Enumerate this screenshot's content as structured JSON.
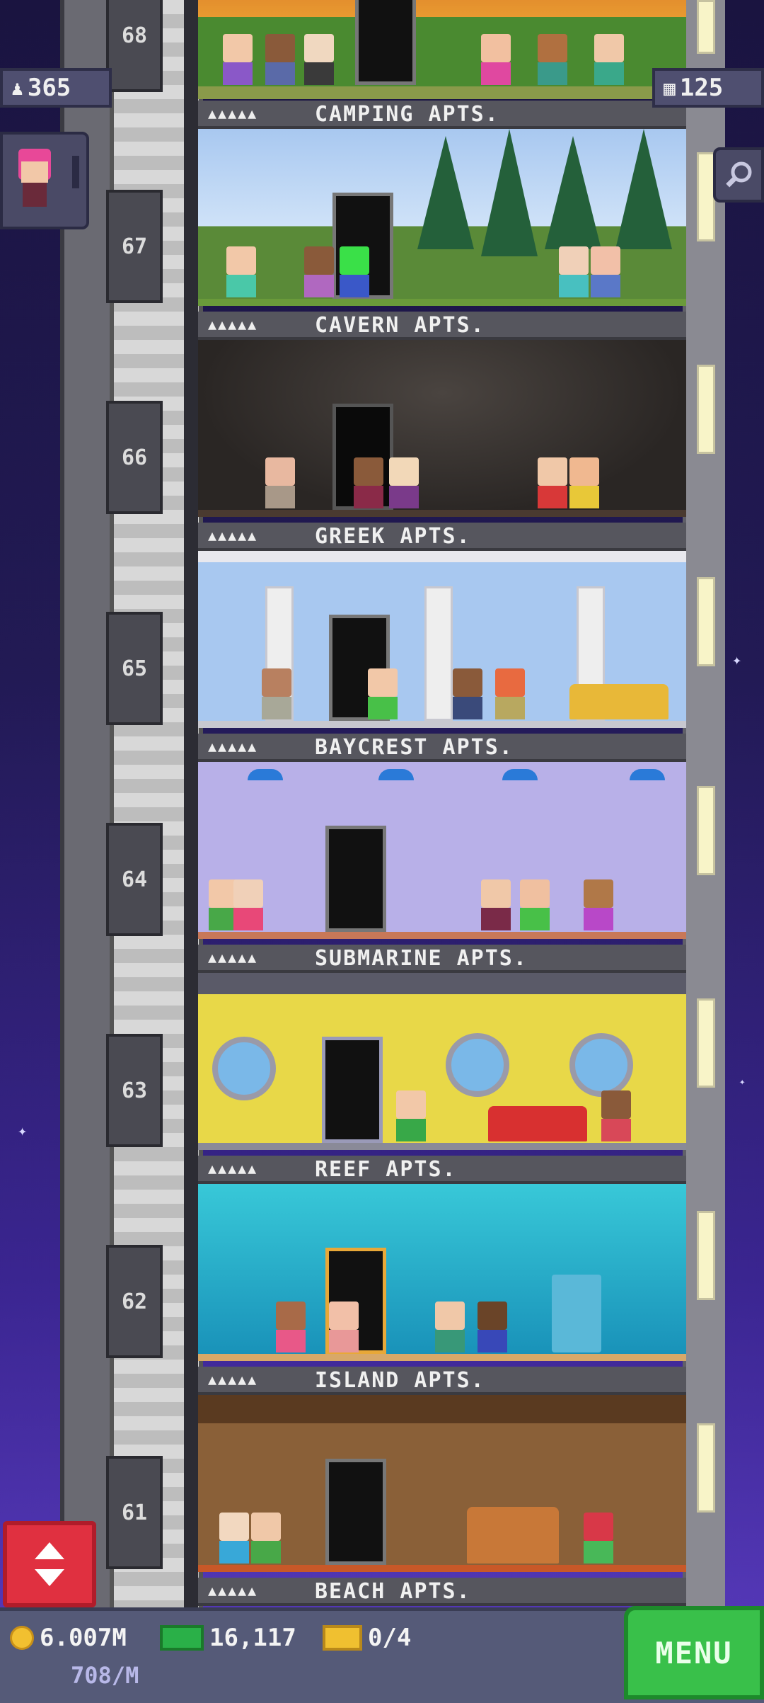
{
  "hud": {
    "population": "365",
    "floors_count": "125",
    "icons": {
      "population": "person-icon",
      "floors": "building-icon",
      "search": "search-icon",
      "elevator": "elevator-arrows-icon"
    }
  },
  "floors": [
    {
      "number": "68",
      "name": "CAMPING APTS.",
      "stars": "▲▲▲▲▲"
    },
    {
      "number": "67",
      "name": "CAVERN APTS.",
      "stars": "▲▲▲▲▲"
    },
    {
      "number": "66",
      "name": "GREEK APTS.",
      "stars": "▲▲▲▲▲"
    },
    {
      "number": "65",
      "name": "BAYCREST APTS.",
      "stars": "▲▲▲▲▲"
    },
    {
      "number": "64",
      "name": "SUBMARINE APTS.",
      "stars": "▲▲▲▲▲"
    },
    {
      "number": "63",
      "name": "REEF APTS.",
      "stars": "▲▲▲▲▲"
    },
    {
      "number": "62",
      "name": "ISLAND APTS.",
      "stars": "▲▲▲▲▲"
    },
    {
      "number": "61",
      "name": "BEACH APTS.",
      "stars": "▲▲▲▲▲"
    }
  ],
  "bottom_bar": {
    "coins": "6.007M",
    "coin_rate": "708/M",
    "bux": "16,117",
    "tickets": "0/4",
    "menu_label": "MENU"
  },
  "colors": {
    "accent_menu": "#39c04a",
    "elevator_button": "#e03040",
    "sky": "#221a55"
  }
}
